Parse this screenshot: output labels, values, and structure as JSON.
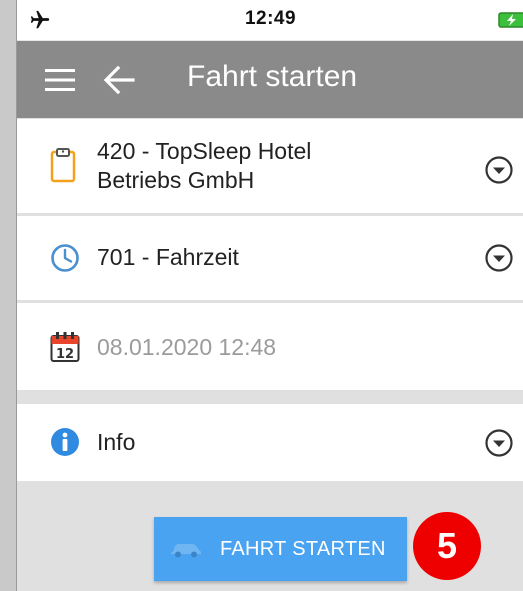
{
  "status_bar": {
    "time": "12:49"
  },
  "app_bar": {
    "title": "Fahrt starten"
  },
  "form": {
    "customer": {
      "line1": "420 - TopSleep Hotel",
      "line2": "Betriebs GmbH"
    },
    "activity": {
      "value": "701 - Fahrzeit"
    },
    "datetime": {
      "value": "08.01.2020 12:48",
      "calendar_day": "12"
    },
    "info": {
      "label": "Info"
    }
  },
  "start_button": {
    "label": "FAHRT STARTEN"
  },
  "step_badge": {
    "number": "5"
  },
  "colors": {
    "app_bar": "#8a8a8a",
    "primary_button": "#4aa3f0",
    "clipboard_orange": "#f4a21b",
    "clock_blue": "#4a8fcf",
    "info_blue": "#2f8ae0",
    "badge_red": "#ee0000",
    "battery_green": "#3cbf3c"
  },
  "icons": {
    "status": [
      "airplane-icon",
      "battery-charging-icon"
    ],
    "app_bar": [
      "menu-icon",
      "back-arrow-icon"
    ],
    "rows": [
      "clipboard-icon",
      "clock-icon",
      "calendar-icon",
      "info-icon"
    ],
    "row_action": "chevron-down-circle-icon",
    "button": "car-icon"
  }
}
